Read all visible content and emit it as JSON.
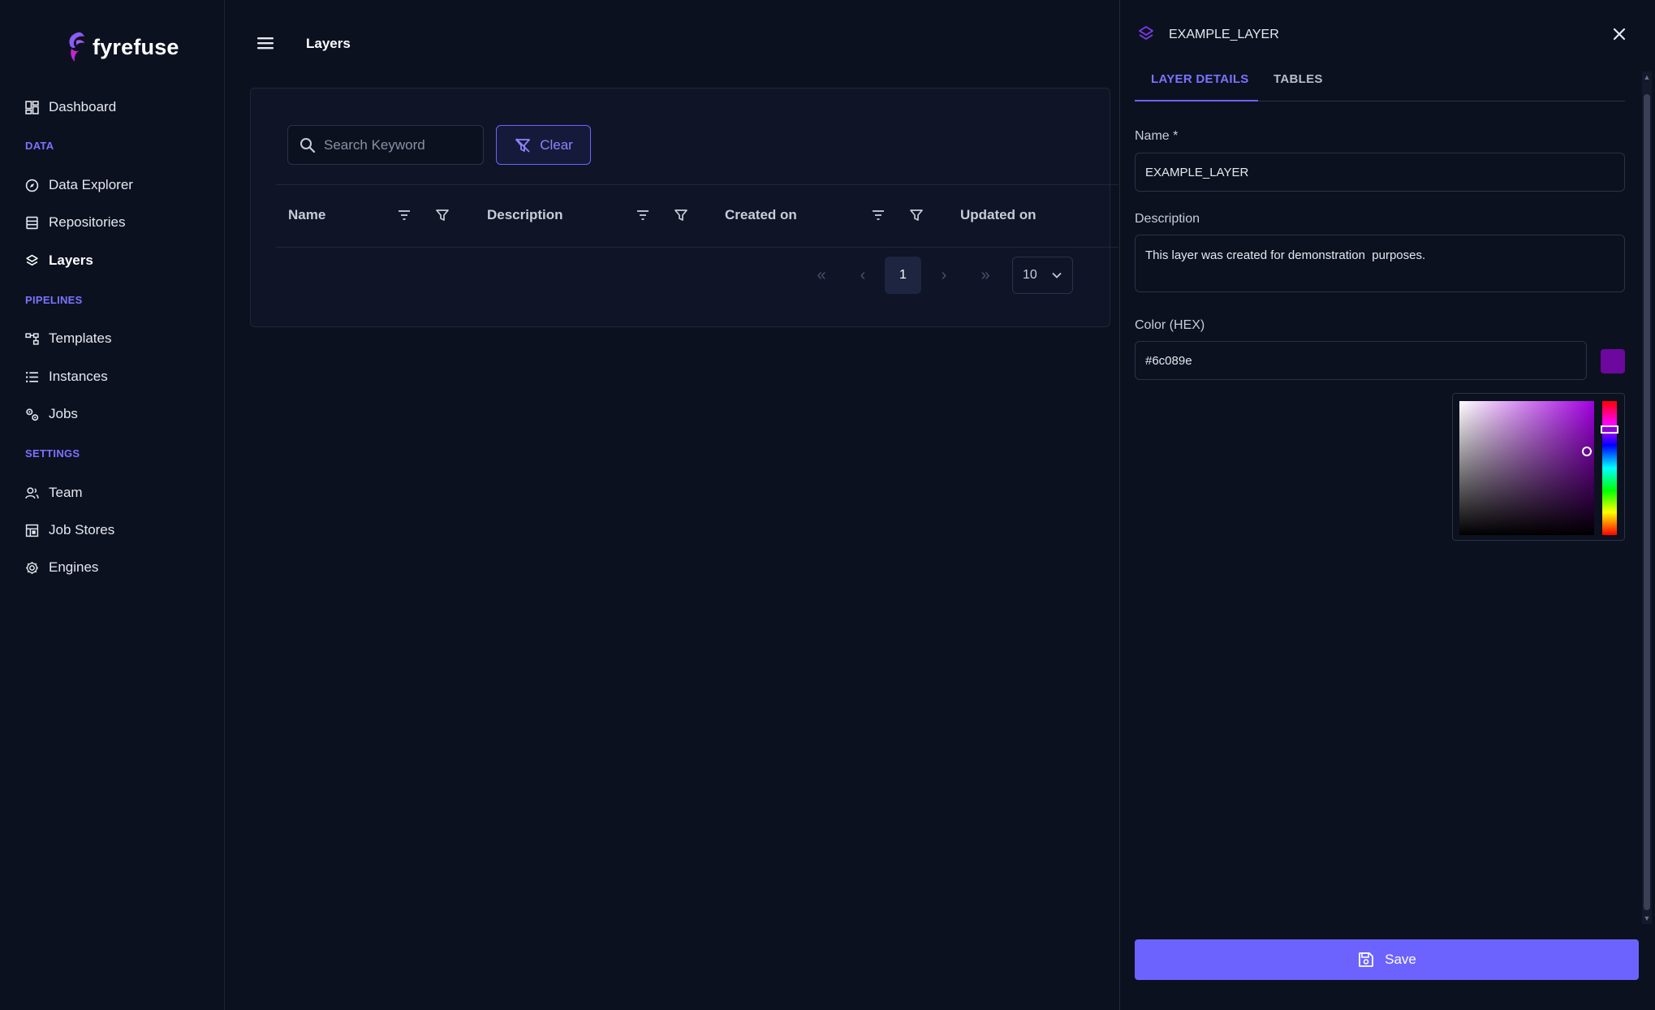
{
  "app": {
    "name": "fyrefuse"
  },
  "sidebar": {
    "items": [
      {
        "label": "Dashboard",
        "icon": "dashboard-icon"
      },
      {
        "label": "Data Explorer",
        "icon": "compass-icon"
      },
      {
        "label": "Repositories",
        "icon": "database-icon"
      },
      {
        "label": "Layers",
        "icon": "layers-icon",
        "active": true
      },
      {
        "label": "Templates",
        "icon": "workflow-icon"
      },
      {
        "label": "Instances",
        "icon": "list-icon"
      },
      {
        "label": "Jobs",
        "icon": "gears-icon"
      },
      {
        "label": "Team",
        "icon": "team-icon"
      },
      {
        "label": "Job Stores",
        "icon": "job-store-icon"
      },
      {
        "label": "Engines",
        "icon": "engine-icon"
      }
    ],
    "sections": {
      "data": "DATA",
      "pipelines": "PIPELINES",
      "settings": "SETTINGS"
    }
  },
  "header": {
    "title": "Layers"
  },
  "toolbar": {
    "search_placeholder": "Search Keyword",
    "clear_label": "Clear"
  },
  "table": {
    "columns": [
      "Name",
      "Description",
      "Created on",
      "Updated on"
    ]
  },
  "pagination": {
    "current_page": "1",
    "page_size": "10",
    "first": "«",
    "prev": "‹",
    "next": "›",
    "last": "»"
  },
  "drawer": {
    "title": "EXAMPLE_LAYER",
    "tabs": [
      "LAYER DETAILS",
      "TABLES"
    ],
    "active_tab": "LAYER DETAILS",
    "fields": {
      "name_label": "Name *",
      "name_value": "EXAMPLE_LAYER",
      "description_label": "Description",
      "description_value": "This layer was created for demonstration  purposes.",
      "color_label": "Color (HEX)",
      "color_value": "#6c089e"
    },
    "save_label": "Save"
  },
  "colors": {
    "accent": "#6c63ff",
    "background": "#0c1120",
    "layer_color": "#6c089e"
  }
}
